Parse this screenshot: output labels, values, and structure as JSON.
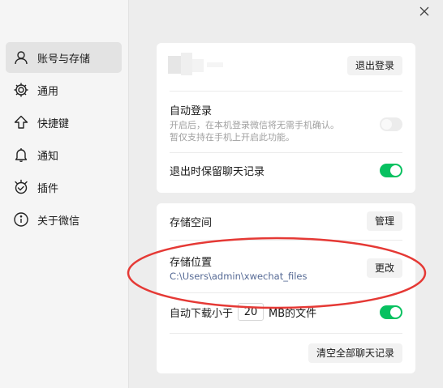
{
  "sidebar": {
    "items": [
      {
        "label": "账号与存储",
        "icon": "person-icon",
        "active": true
      },
      {
        "label": "通用",
        "icon": "gear-icon",
        "active": false
      },
      {
        "label": "快捷键",
        "icon": "up-arrow-icon",
        "active": false
      },
      {
        "label": "通知",
        "icon": "bell-icon",
        "active": false
      },
      {
        "label": "插件",
        "icon": "plugin-icon",
        "active": false
      },
      {
        "label": "关于微信",
        "icon": "info-icon",
        "active": false
      }
    ]
  },
  "account": {
    "logout_label": "退出登录",
    "auto_login_title": "自动登录",
    "auto_login_desc_1": "开启后，在本机登录微信将无需手机确认。",
    "auto_login_desc_2": "暂仅支持在手机上开启此功能。",
    "auto_login_on": false,
    "keep_history_title": "退出时保留聊天记录",
    "keep_history_on": true
  },
  "storage": {
    "space_title": "存储空间",
    "manage_label": "管理",
    "location_title": "存储位置",
    "location_path": "C:\\Users\\admin\\xwechat_files",
    "change_label": "更改",
    "auto_download_prefix": "自动下载小于",
    "auto_download_value": "20",
    "auto_download_suffix": "MB的文件",
    "auto_download_on": true,
    "clear_label": "清空全部聊天记录"
  },
  "colors": {
    "toggle_on": "#07c160",
    "annotation_red": "#e53935",
    "path_link": "#566a95"
  }
}
